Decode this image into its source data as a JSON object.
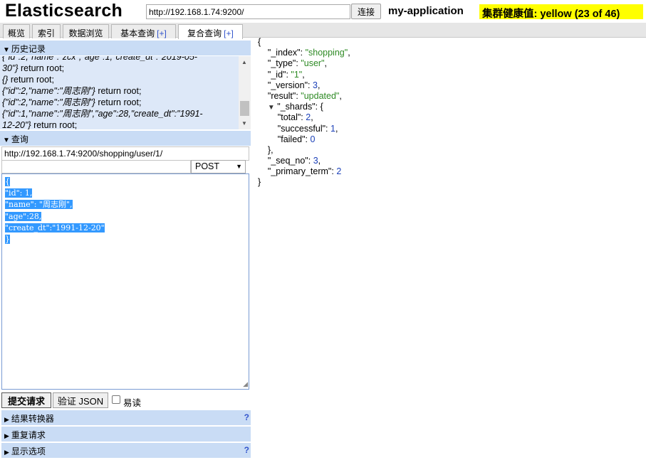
{
  "header": {
    "title": "Elasticsearch",
    "url": "http://192.168.1.74:9200/",
    "connect_label": "连接",
    "cluster_name": "my-application",
    "health": "集群健康值: yellow (23 of 46)",
    "health_color": "#ffff00"
  },
  "tabs": [
    {
      "label": "概览"
    },
    {
      "label": "索引"
    },
    {
      "label": "数据浏览"
    },
    {
      "label": "基本查询",
      "plus": "[+]"
    },
    {
      "label": "复合查询",
      "plus": "[+]",
      "active": true
    }
  ],
  "history": {
    "title": "历史记录",
    "items": [
      {
        "json": "{\"id\":2,\"name\":\"zcx\",\"age\":1,\"create_dt\":\"2019-05-",
        "suffix": ""
      },
      {
        "json": "30\"}",
        "suffix": " return root;"
      },
      {
        "json": "{}",
        "suffix": " return root;"
      },
      {
        "json": "{\"id\":2,\"name\":\"周志刚\"}",
        "suffix": " return root;"
      },
      {
        "json": "{\"id\":2,\"name\":\"周志刚\"}",
        "suffix": " return root;"
      },
      {
        "json": "{\"id\":1,\"name\":\"周志刚\",\"age\":28,\"create_dt\":\"1991-",
        "suffix": ""
      },
      {
        "json": "12-20\"}",
        "suffix": " return root;"
      }
    ]
  },
  "query": {
    "title": "查询",
    "url": "http://192.168.1.74:9200/shopping/user/1/",
    "method": "POST",
    "body_lines": [
      "{",
      "\"id\": 1,",
      "\"name\": \"周志刚\",",
      "\"age\":28,",
      "\"create_dt\":\"1991-12-20\"",
      "}"
    ],
    "submit_label": "提交请求",
    "validate_label": "验证 JSON",
    "easy_read_label": "易读"
  },
  "panels": [
    {
      "label": "结果转换器",
      "help": "?"
    },
    {
      "label": "重复请求",
      "help": ""
    },
    {
      "label": "显示选项",
      "help": "?"
    }
  ],
  "result": {
    "_index": "\"shopping\"",
    "_type": "\"user\"",
    "_id": "\"1\"",
    "_version": "3",
    "result": "\"updated\"",
    "_shards_total": "2",
    "_shards_successful": "1",
    "_shards_failed": "0",
    "_seq_no": "3",
    "_primary_term": "2"
  }
}
